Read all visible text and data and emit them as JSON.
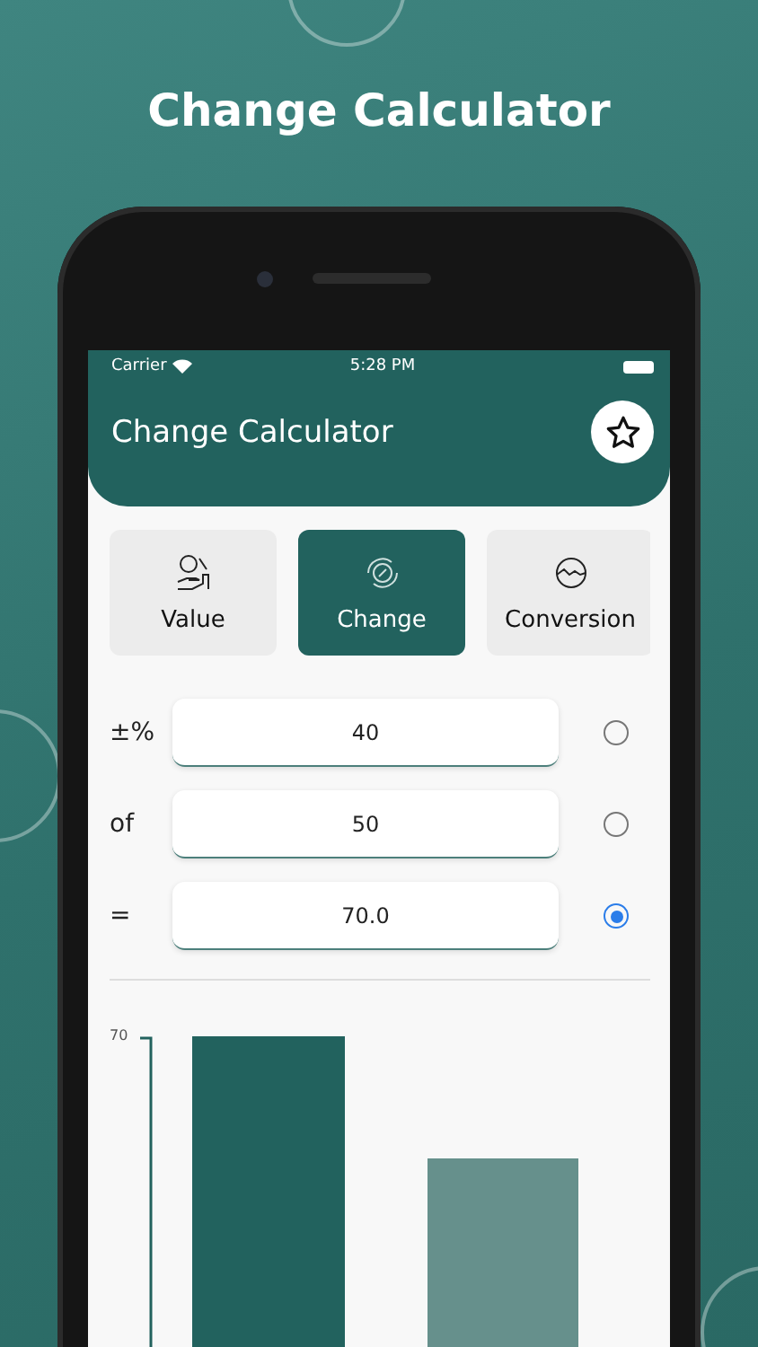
{
  "headline": "Change Calculator",
  "status_bar": {
    "carrier": "Carrier",
    "time": "5:28 PM"
  },
  "app_bar": {
    "title": "Change Calculator"
  },
  "tabs": [
    {
      "label": "Value",
      "selected": false
    },
    {
      "label": "Change",
      "selected": true
    },
    {
      "label": "Conversion",
      "selected": false
    }
  ],
  "rows": [
    {
      "label": "±%",
      "value": "40",
      "selected": false
    },
    {
      "label": "of",
      "value": "50",
      "selected": false
    },
    {
      "label": "=",
      "value": "70.0",
      "selected": true
    }
  ],
  "chart": {
    "tick_label": "70"
  }
}
